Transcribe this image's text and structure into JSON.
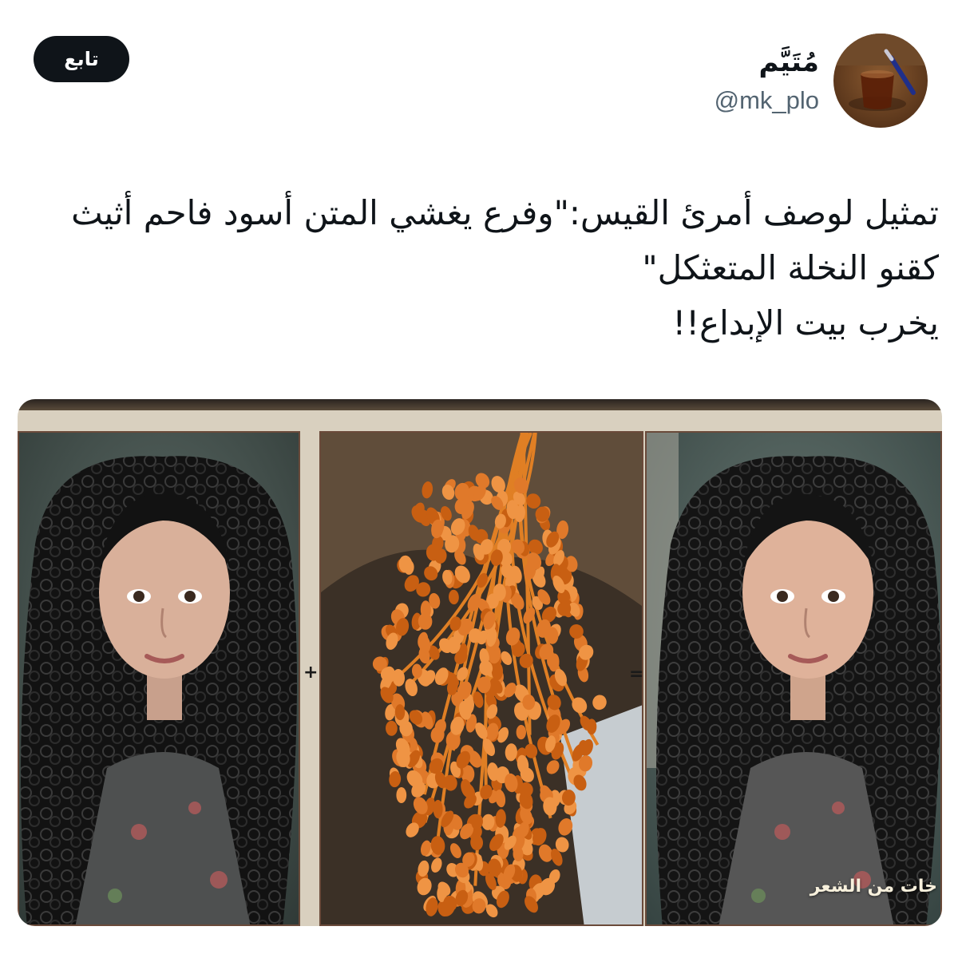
{
  "header": {
    "follow_label": "تابع",
    "display_name": "مُتَيَّم",
    "handle": "@mk_plo"
  },
  "tweet": {
    "lines": [
      "تمثيل لوصف أمرئ القيس:\"وفرع يغشي المتن أسود فاحم أثيث",
      "كقنو النخلة المتعثكل\"",
      "يخرب بيت الإبداع!!"
    ]
  },
  "media": {
    "operators": {
      "plus": "+",
      "equals": "="
    },
    "caption": "خات من الشعر",
    "colors": {
      "hair": "#141414",
      "dates": "#d9731e",
      "frame": "#d9d0bf",
      "backdrop": "#4a5a55"
    }
  },
  "theme": {
    "text": "#0f1419",
    "secondary_text": "#536471",
    "button_bg": "#0f1419",
    "button_text": "#ffffff"
  }
}
